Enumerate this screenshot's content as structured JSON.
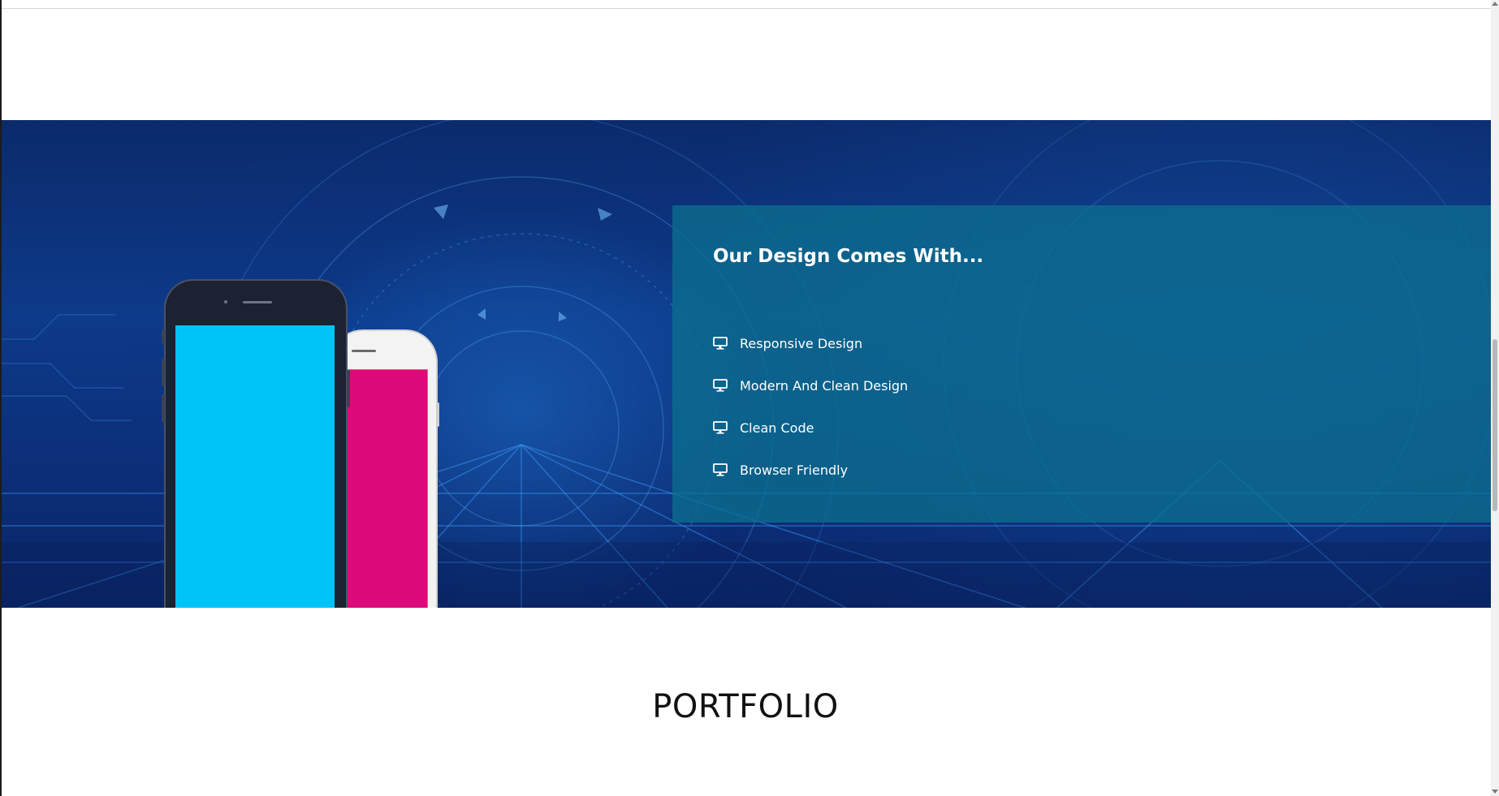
{
  "feature_section": {
    "title": "Our Design Comes With...",
    "items": [
      {
        "label": "Responsive Design",
        "icon": "monitor-icon"
      },
      {
        "label": "Modern And Clean Design",
        "icon": "monitor-icon"
      },
      {
        "label": "Clean Code",
        "icon": "monitor-icon"
      },
      {
        "label": "Browser Friendly",
        "icon": "monitor-icon"
      }
    ],
    "panel_color": "#0c6e8e",
    "background_color": "#0d3a8a",
    "phone_front_screen_color": "#00c4f8",
    "phone_back_screen_color": "#dc0a7a"
  },
  "portfolio": {
    "heading": "PORTFOLIO"
  }
}
